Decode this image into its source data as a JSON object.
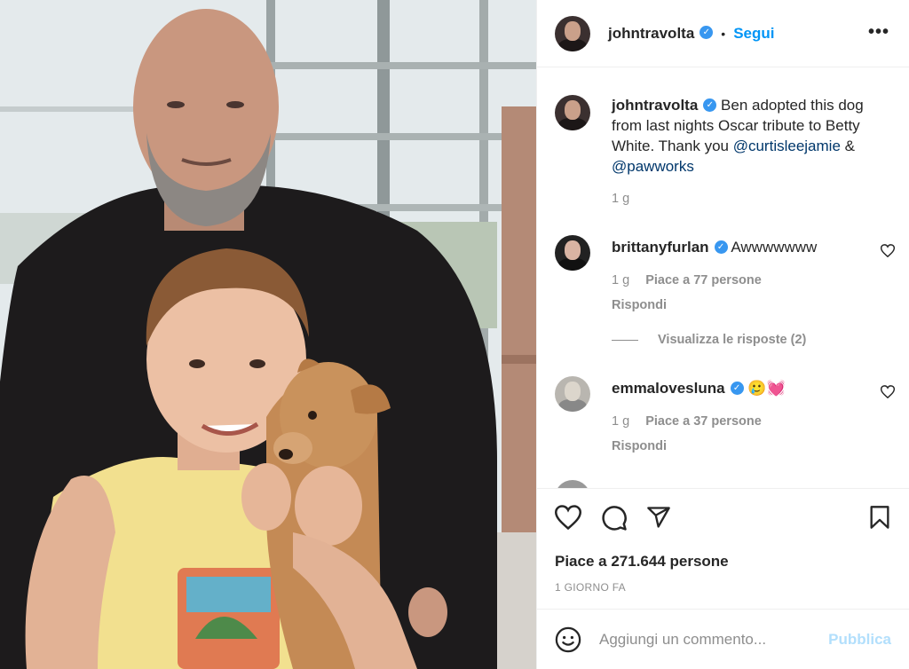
{
  "post": {
    "image_alt": "Photo: man in black jacket with a boy holding a small tan puppy",
    "author": "johntravolta",
    "follow_label": "Segui",
    "more_label": "•••"
  },
  "caption": {
    "username": "johntravolta",
    "text_before": "Ben adopted this dog from last nights Oscar tribute to Betty White. Thank you",
    "mention1": "@curtisleejamie",
    "conj": "&",
    "mention2": "@pawworks",
    "time": "1 g"
  },
  "comments": [
    {
      "username": "brittanyfurlan",
      "text": "Awwwwwww",
      "time": "1 g",
      "likes": "Piace a 77 persone",
      "reply": "Rispondi",
      "view_replies": "Visualizza le risposte (2)"
    },
    {
      "username": "emmalovesluna",
      "text": "🥲💓",
      "time": "1 g",
      "likes": "Piace a 37 persone",
      "reply": "Rispondi"
    }
  ],
  "actions": {
    "likes": "Piace a 271.644 persone",
    "time_ago": "1 GIORNO FA"
  },
  "add_comment": {
    "placeholder": "Aggiungi un commento...",
    "publish": "Pubblica"
  },
  "icons": {
    "verified": "verified-badge-icon",
    "like": "heart-icon",
    "comment": "comment-icon",
    "share": "paper-plane-icon",
    "save": "bookmark-icon",
    "emoji": "emoji-icon"
  },
  "colors": {
    "accent": "#0095f6",
    "verified": "#3897f0",
    "mention": "#00376b",
    "muted": "#8e8e8e",
    "publish_disabled": "#b2dffc"
  }
}
